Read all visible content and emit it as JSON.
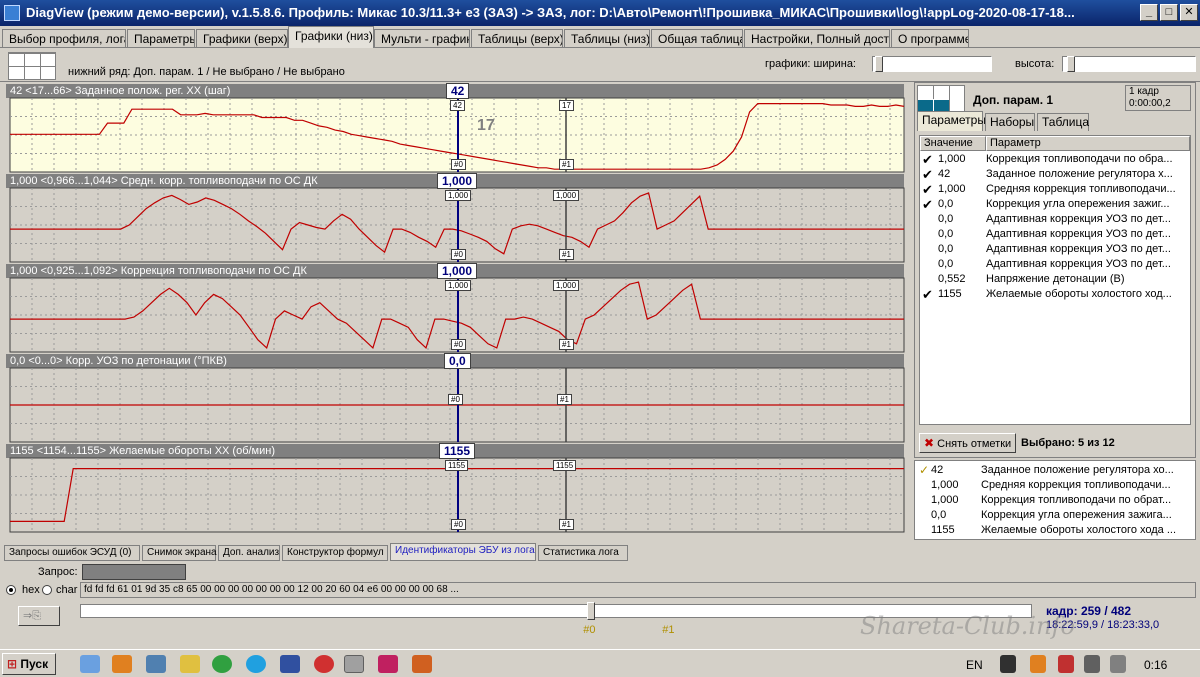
{
  "window": {
    "title": "DiagView (режим демо-версии), v.1.5.8.6. Профиль: Микас 10.3/11.3+ е3 (ЗАЗ) -> ЗАЗ,   лог: D:\\Авто\\Ремонт\\!Прошивка_МИКАС\\Прошивки\\log\\!appLog-2020-08-17-18...",
    "minimize": "_",
    "maximize": "□",
    "close": "✕"
  },
  "tabs": [
    "Выбор профиля, лога",
    "Параметры",
    "Графики (верх)",
    "Графики (низ)",
    "Мульти - график",
    "Таблицы (верх)",
    "Таблицы (низ)",
    "Общая таблица",
    "Настройки, Полный доступ",
    "О программе"
  ],
  "subheader": {
    "label": "нижний ряд: Доп. парам. 1 / Не выбрано / Не выбрано",
    "width_label": "графики:  ширина:",
    "height_label": "высота:"
  },
  "charts": [
    {
      "header": "42    <17...66>   Заданное полож. рег. ХХ (шаг)",
      "value": "42",
      "m0": "42",
      "m1": "17",
      "big": "17",
      "f0": "#0",
      "f1": "#1"
    },
    {
      "header": "1,000    <0,966...1,044>   Средн. корр. топливоподачи по ОС ДК",
      "value": "1,000",
      "m0": "1,000",
      "m1": "1,000",
      "f0": "#0",
      "f1": "#1"
    },
    {
      "header": "1,000    <0,925...1,092>   Коррекция топливоподачи по ОС ДК",
      "value": "1,000",
      "m0": "1,000",
      "m1": "1,000",
      "f0": "#0",
      "f1": "#1"
    },
    {
      "header": "0,0    <0...0>   Корр. УОЗ по детонации (°ПКВ)",
      "value": "0,0",
      "m0": "#0",
      "m1": "#1"
    },
    {
      "header": "1155    <1154...1155>   Желаемые обороты ХХ (об/мин)",
      "value": "1155",
      "m0": "1155",
      "m1": "1155",
      "f0": "#0",
      "f1": "#1"
    }
  ],
  "chart_data": [
    {
      "type": "line",
      "color": "#c00000",
      "grid": true,
      "background": "#fdfde0",
      "values": [
        42,
        42,
        42,
        42,
        42,
        42,
        42,
        42,
        42,
        42,
        42,
        42,
        50,
        50,
        50,
        60,
        60,
        60,
        60,
        60,
        60,
        56,
        56,
        56,
        57,
        56,
        56,
        56,
        56,
        56,
        56,
        54,
        54,
        54,
        54,
        52,
        52,
        50,
        48,
        47,
        45,
        44,
        42,
        41,
        40,
        39,
        38,
        37,
        35,
        34,
        33,
        32,
        31,
        30,
        29,
        28,
        27,
        26,
        25,
        24,
        23,
        22,
        21,
        20,
        19,
        18,
        18,
        17,
        17,
        17,
        17,
        17,
        17,
        17,
        17,
        17,
        17,
        17,
        17,
        17,
        17,
        17,
        17,
        17,
        17,
        17,
        18,
        20,
        24,
        30,
        40,
        58,
        64,
        64,
        64,
        64,
        64,
        64,
        64,
        64,
        64,
        63,
        63,
        63,
        62,
        62,
        63,
        62,
        62,
        63,
        62
      ],
      "ylim": [
        15,
        68
      ]
    },
    {
      "type": "line",
      "color": "#c00000",
      "grid": true,
      "background": "#d4d0c8",
      "values": [
        1.0,
        1.0,
        1.0,
        1.0,
        1.0,
        1.0,
        1.0,
        1.0,
        1.0,
        1.0,
        1.0,
        1.0,
        1.0,
        1.0,
        1.005,
        1.015,
        1.025,
        1.032,
        1.038,
        1.041,
        1.036,
        1.03,
        1.033,
        1.038,
        1.035,
        1.03,
        1.025,
        1.018,
        1.01,
        1.003,
        0.995,
        0.985,
        0.975,
        1.0,
        1.008,
        1.005,
        1.002,
        1.0,
        1.01,
        1.018,
        1.012,
        1.0,
        0.99,
        0.98,
        0.972,
        1.0,
        1.0,
        0.996,
        0.99,
        0.985,
        0.978,
        1.0,
        1.0,
        0.998,
        0.994,
        0.99,
        0.985,
        0.976,
        0.97,
        1.0,
        1.004,
        1.006,
        1.004,
        1.0,
        0.996,
        0.992,
        0.99,
        0.985,
        0.978,
        1.0,
        1.005,
        1.01,
        1.02,
        1.032,
        1.04,
        1.044,
        1.0,
        1.005,
        1.01,
        1.02,
        1.03,
        1.04,
        1.0,
        1.0,
        1.0,
        1.0,
        1.0,
        1.0,
        1.0,
        1.0,
        1.0,
        1.0,
        1.0,
        1.0,
        1.0,
        1.0,
        1.0,
        1.0,
        1.0,
        1.0,
        1.0,
        1.0,
        1.0,
        1.0,
        1.0,
        1.0
      ],
      "ylim": [
        0.96,
        1.05
      ]
    },
    {
      "type": "line",
      "color": "#c00000",
      "grid": true,
      "background": "#d4d0c8",
      "values": [
        1.0,
        1.0,
        1.0,
        1.0,
        1.0,
        1.0,
        1.0,
        1.0,
        1.0,
        1.0,
        1.0,
        1.0,
        1.0,
        1.0,
        1.005,
        1.02,
        1.04,
        1.06,
        1.075,
        1.06,
        1.04,
        1.01,
        1.04,
        1.06,
        1.05,
        1.03,
        1.01,
        0.98,
        0.95,
        0.93,
        1.0,
        1.02,
        1.01,
        1.0,
        1.03,
        1.04,
        1.02,
        1.0,
        0.99,
        0.97,
        0.95,
        0.93,
        1.0,
        1.0,
        0.99,
        0.98,
        0.95,
        0.93,
        1.0,
        1.0,
        0.995,
        0.99,
        0.98,
        0.96,
        0.94,
        0.93,
        1.0,
        1.0,
        1.005,
        1.0,
        0.99,
        0.98,
        0.97,
        0.95,
        0.94,
        1.0,
        1.01,
        1.03,
        1.05,
        1.07,
        1.085,
        1.09,
        1.0,
        1.01,
        1.03,
        1.05,
        1.07,
        1.085,
        1.0,
        1.0,
        1.0,
        1.0,
        1.0,
        1.0,
        1.0,
        1.0,
        1.0,
        1.0,
        1.0,
        1.0,
        1.0,
        1.0,
        1.0,
        1.0,
        1.0,
        1.0,
        1.0,
        1.0,
        1.0,
        1.0,
        1.0,
        1.0
      ],
      "ylim": [
        0.92,
        1.1
      ]
    },
    {
      "type": "line",
      "color": "#c00000",
      "grid": true,
      "background": "#d4d0c8",
      "values": [
        0,
        0,
        0,
        0,
        0,
        0,
        0,
        0,
        0,
        0,
        0,
        0,
        0,
        0,
        0,
        0,
        0,
        0,
        0,
        0,
        0,
        0,
        0,
        0,
        0,
        0,
        0,
        0,
        0,
        0,
        0,
        0,
        0,
        0,
        0,
        0,
        0,
        0,
        0,
        0
      ],
      "ylim": [
        -1,
        1
      ]
    },
    {
      "type": "line",
      "color": "#c00000",
      "grid": true,
      "background": "#d4d0c8",
      "values": [
        1154,
        1154,
        1154,
        1154,
        1154,
        1154,
        1154,
        1155,
        1155,
        1155,
        1155,
        1155,
        1155,
        1155,
        1155,
        1155,
        1155,
        1155,
        1155,
        1155,
        1155,
        1155,
        1155,
        1155,
        1155,
        1155,
        1155,
        1155,
        1155,
        1155,
        1155,
        1155,
        1155,
        1155,
        1155,
        1155,
        1155,
        1155,
        1155,
        1155,
        1155,
        1155,
        1155,
        1155,
        1155,
        1155,
        1155,
        1155,
        1155,
        1155,
        1155,
        1155,
        1155,
        1155,
        1155,
        1155,
        1155,
        1155,
        1155,
        1155,
        1155,
        1155,
        1155,
        1155,
        1155,
        1155,
        1155,
        1155,
        1155,
        1155,
        1155,
        1155,
        1155,
        1155,
        1155,
        1155,
        1155,
        1155,
        1155,
        1155,
        1155,
        1155,
        1155,
        1155,
        1155,
        1155,
        1155,
        1155,
        1155,
        1155,
        1155,
        1155,
        1155,
        1155,
        1155,
        1155,
        1155,
        1155,
        1155,
        1155
      ],
      "ylim": [
        1153.8,
        1155.2
      ]
    }
  ],
  "right_panel": {
    "title": "Доп. парам. 1",
    "frame": "1 кадр",
    "time": "0:00:00,2",
    "tabs": [
      "Параметры",
      "Наборы",
      "Таблица"
    ],
    "col_value": "Значение",
    "col_param": "Параметр",
    "rows": [
      {
        "checked": true,
        "value": "1,000",
        "name": "Коррекция топливоподачи по обра..."
      },
      {
        "checked": true,
        "value": "42",
        "name": "Заданное положение регулятора х..."
      },
      {
        "checked": true,
        "value": "1,000",
        "name": "Средняя коррекция топливоподачи..."
      },
      {
        "checked": true,
        "value": "0,0",
        "name": "Коррекция угла опережения зажиг..."
      },
      {
        "checked": false,
        "value": "0,0",
        "name": "Адаптивная коррекция УОЗ по дет..."
      },
      {
        "checked": false,
        "value": "0,0",
        "name": "Адаптивная коррекция УОЗ по дет..."
      },
      {
        "checked": false,
        "value": "0,0",
        "name": "Адаптивная коррекция УОЗ по дет..."
      },
      {
        "checked": false,
        "value": "0,0",
        "name": "Адаптивная коррекция УОЗ по дет..."
      },
      {
        "checked": false,
        "value": "0,552",
        "name": "Напряжение детонации (В)"
      },
      {
        "checked": true,
        "value": "1155",
        "name": "Желаемые обороты холостого ход..."
      }
    ],
    "clear_button": "Снять отметки",
    "selected": "Выбрано: 5 из 12"
  },
  "selected_list": [
    {
      "value": "42",
      "name": "Заданное положение регулятора хо..."
    },
    {
      "value": "1,000",
      "name": "Средняя коррекция топливоподачи..."
    },
    {
      "value": "1,000",
      "name": "Коррекция топливоподачи по обрат..."
    },
    {
      "value": "0,0",
      "name": "Коррекция угла опережения зажига..."
    },
    {
      "value": "1155",
      "name": "Желаемые обороты холостого хода ..."
    }
  ],
  "bottom_tabs": [
    "Запросы ошибок ЭСУД (0)",
    "Снимок экрана",
    "Доп. анализ",
    "Конструктор формул",
    "Идентификаторы ЭБУ из лога",
    "Статистика лога"
  ],
  "request": {
    "label": "Запрос:",
    "hex_label": "hex",
    "char_label": "char",
    "hex_data": "fd fd fd 61 01 9d 35 c8 65 00 00 00 00 00 00 00 12 00 20 60 04 e6 00 00 00 00 68 ..."
  },
  "timeline": {
    "frame": "кадр: 259 / 482",
    "times": "18:22:59,9 / 18:23:33,0",
    "marker0": "#0",
    "marker1": "#1",
    "position": 0.537,
    "marker1_position": 0.62
  },
  "watermark": "Shareta-Club.info",
  "taskbar": {
    "start": "Пуск",
    "lang": "EN",
    "clock": "0:16"
  }
}
